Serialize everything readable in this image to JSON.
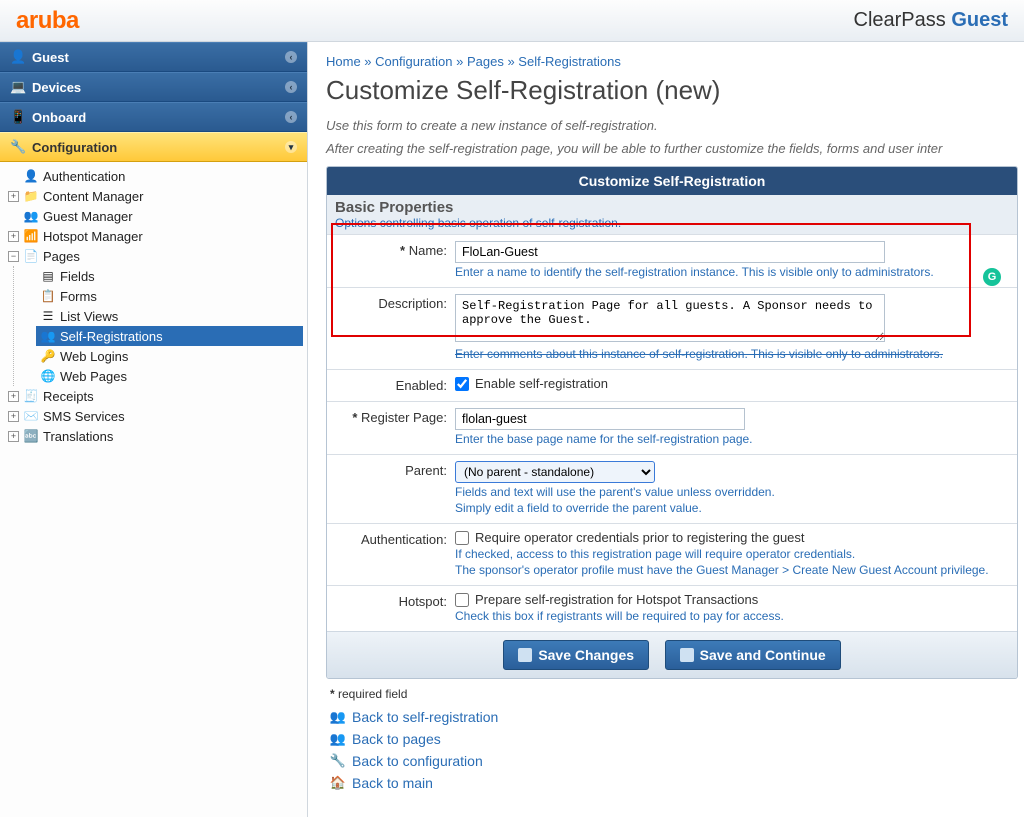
{
  "header": {
    "logo": "aruba",
    "product_a": "ClearPass ",
    "product_b": "Guest"
  },
  "nav": {
    "sections": [
      {
        "label": "Guest"
      },
      {
        "label": "Devices"
      },
      {
        "label": "Onboard"
      },
      {
        "label": "Configuration"
      }
    ]
  },
  "tree": {
    "auth": "Authentication",
    "content": "Content Manager",
    "guest": "Guest Manager",
    "hotspot": "Hotspot Manager",
    "pages": "Pages",
    "pages_children": {
      "fields": "Fields",
      "forms": "Forms",
      "lists": "List Views",
      "selfreg": "Self-Registrations",
      "weblogins": "Web Logins",
      "webpages": "Web Pages"
    },
    "receipts": "Receipts",
    "sms": "SMS Services",
    "translations": "Translations"
  },
  "breadcrumb": {
    "a": "Home",
    "b": "Configuration",
    "c": "Pages",
    "d": "Self-Registrations"
  },
  "page": {
    "title": "Customize Self-Registration (new)",
    "hint1": "Use this form to create a new instance of self-registration.",
    "hint2": "After creating the self-registration page, you will be able to further customize the fields, forms and user inter"
  },
  "section": {
    "title": "Customize Self-Registration",
    "subhead": "Basic Properties",
    "subhelp": "Options controlling basic operation of self-registration."
  },
  "form": {
    "name_label": "Name:",
    "name_value": "FloLan-Guest",
    "name_help": "Enter a name to identify the self-registration instance. This is visible only to administrators.",
    "desc_label": "Description:",
    "desc_value": "Self-Registration Page for all guests. A Sponsor needs to approve the Guest.",
    "desc_help": "Enter comments about this instance of self-registration. This is visible only to administrators.",
    "enabled_label": "Enabled:",
    "enabled_ck": "Enable self-registration",
    "regpage_label": "Register Page:",
    "regpage_value": "flolan-guest",
    "regpage_help": "Enter the base page name for the self-registration page.",
    "parent_label": "Parent:",
    "parent_selected": "(No parent - standalone)",
    "parent_help1": "Fields and text will use the parent's value unless overridden.",
    "parent_help2": "Simply edit a field to override the parent value.",
    "auth_label": "Authentication:",
    "auth_ck": "Require operator credentials prior to registering the guest",
    "auth_help1": "If checked, access to this registration page will require operator credentials.",
    "auth_help2": "The sponsor's operator profile must have the Guest Manager > Create New Guest Account privilege.",
    "hotspot_label": "Hotspot:",
    "hotspot_ck": "Prepare self-registration for Hotspot Transactions",
    "hotspot_help": "Check this box if registrants will be required to pay for access."
  },
  "buttons": {
    "save": "Save Changes",
    "cont": "Save and Continue"
  },
  "footnote": "required field",
  "links": {
    "back_selfreg": "Back to self-registration",
    "back_pages": "Back to pages",
    "back_config": "Back to configuration",
    "back_main": "Back to main"
  }
}
